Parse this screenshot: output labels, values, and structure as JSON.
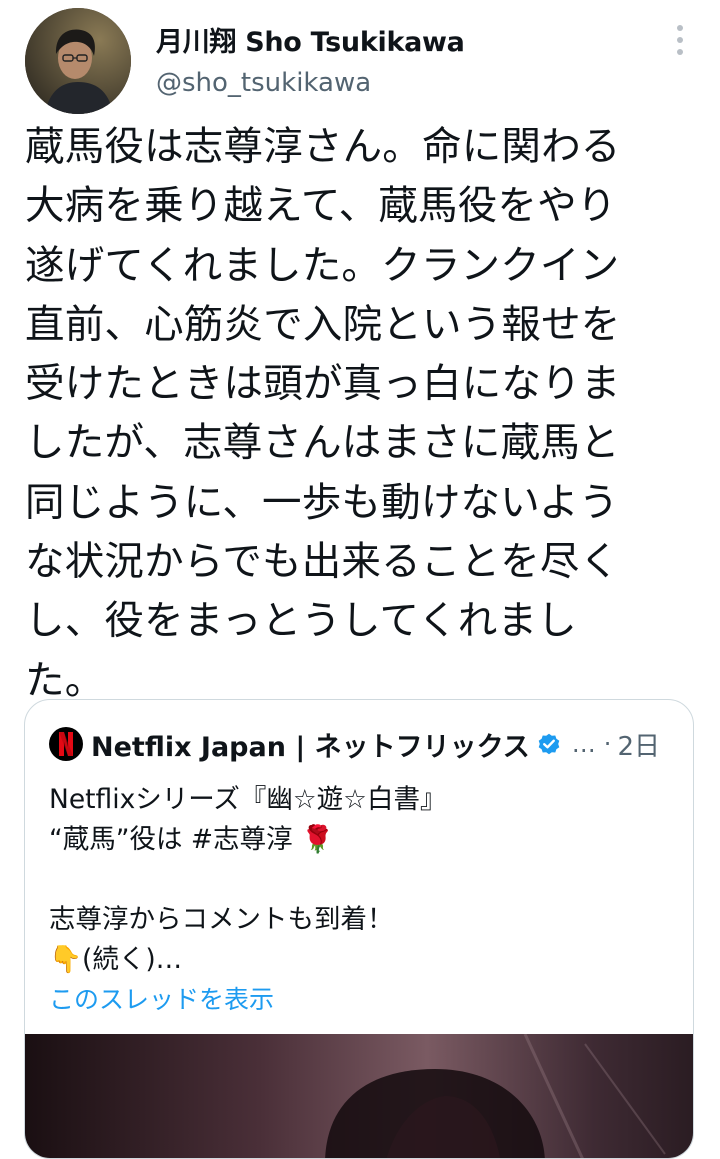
{
  "tweet": {
    "display_name": "月川翔 Sho Tsukikawa",
    "handle": "@sho_tsukikawa",
    "text": "蔵馬役は志尊淳さん。命に関わる\n大病を乗り越えて、蔵馬役をやり\n遂げてくれました。クランクイン\n直前、心筋炎で入院という報せを\n受けたときは頭が真っ白になりま\nしたが、志尊さんはまさに蔵馬と\n同じように、一歩も動けないよう\nな状況からでも出来ることを尽く\nし、役をまっとうしてくれまし\nた。",
    "more_icon": "more-vertical-icon"
  },
  "quote": {
    "name": "Netflix Japan | ネットフリックス",
    "ellipsis": "…",
    "separator": "·",
    "time": "2日",
    "text": "Netflixシリーズ『幽☆遊☆白書』\n“蔵馬”役は #志尊淳 🌹\n\n志尊淳からコメントも到着！\n👇(続く)…",
    "show_thread": "このスレッドを表示",
    "logo_letter": "N",
    "verified_icon": "verified-badge-icon"
  },
  "colors": {
    "link": "#1d9bf0",
    "secondary_text": "#536471",
    "border": "#cfd9de",
    "netflix_red": "#e50914"
  }
}
